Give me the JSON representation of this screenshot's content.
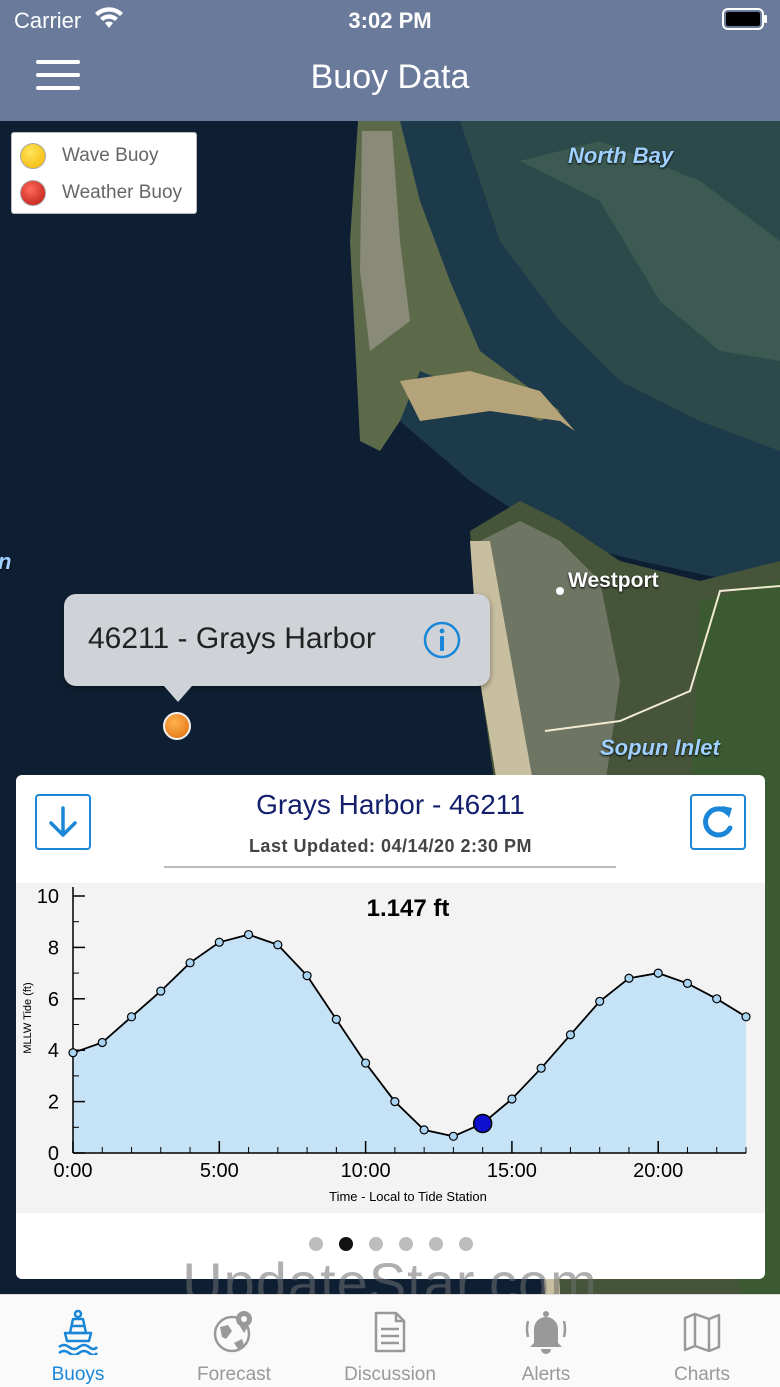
{
  "status": {
    "carrier": "Carrier",
    "time": "3:02 PM"
  },
  "nav": {
    "title": "Buoy Data"
  },
  "legend": {
    "items": [
      {
        "label": "Wave Buoy",
        "color": "#f7c400"
      },
      {
        "label": "Weather Buoy",
        "color": "#d7261e"
      }
    ]
  },
  "map": {
    "labels": {
      "north_bay": "North Bay",
      "westport": "Westport",
      "sopun_inlet": "Sopun Inlet",
      "edge": "n"
    },
    "callout": {
      "title": "46211 - Grays Harbor"
    }
  },
  "card": {
    "title": "Grays Harbor - 46211",
    "updated": "Last Updated: 04/14/20 2:30 PM",
    "pages": 6,
    "active_page": 1
  },
  "chart_data": {
    "type": "area",
    "title": "1.147 ft",
    "xlabel": "Time - Local to Tide Station",
    "ylabel": "MLLW Tide (ft)",
    "ylim": [
      0,
      10
    ],
    "xlim": [
      0,
      23
    ],
    "xticks": [
      "0:00",
      "5:00",
      "10:00",
      "15:00",
      "20:00"
    ],
    "xtick_values": [
      0,
      5,
      10,
      15,
      20
    ],
    "yticks": [
      "0",
      "2",
      "4",
      "6",
      "8",
      "10"
    ],
    "ytick_values": [
      0,
      2,
      4,
      6,
      8,
      10
    ],
    "x": [
      0,
      1,
      2,
      3,
      4,
      5,
      6,
      7,
      8,
      9,
      10,
      11,
      12,
      13,
      14,
      15,
      16,
      17,
      18,
      19,
      20,
      21,
      22,
      23
    ],
    "values": [
      3.9,
      4.3,
      5.3,
      6.3,
      7.4,
      8.2,
      8.5,
      8.1,
      6.9,
      5.2,
      3.5,
      2.0,
      0.9,
      0.65,
      1.147,
      2.1,
      3.3,
      4.6,
      5.9,
      6.8,
      7.0,
      6.6,
      6.0,
      5.3
    ],
    "highlight": {
      "x": 14,
      "y": 1.147
    },
    "colors": {
      "fill": "#c6e2f6",
      "line": "#000000",
      "highlight": "#1010d0",
      "point": "#a8d4f2"
    }
  },
  "watermark": "UpdateStar.com",
  "tabs": [
    {
      "label": "Buoys",
      "icon": "buoy-icon",
      "active": true
    },
    {
      "label": "Forecast",
      "icon": "globe-pin-icon",
      "active": false
    },
    {
      "label": "Discussion",
      "icon": "document-icon",
      "active": false
    },
    {
      "label": "Alerts",
      "icon": "bell-icon",
      "active": false
    },
    {
      "label": "Charts",
      "icon": "map-icon",
      "active": false
    }
  ],
  "accent_color": "#1a86d8"
}
